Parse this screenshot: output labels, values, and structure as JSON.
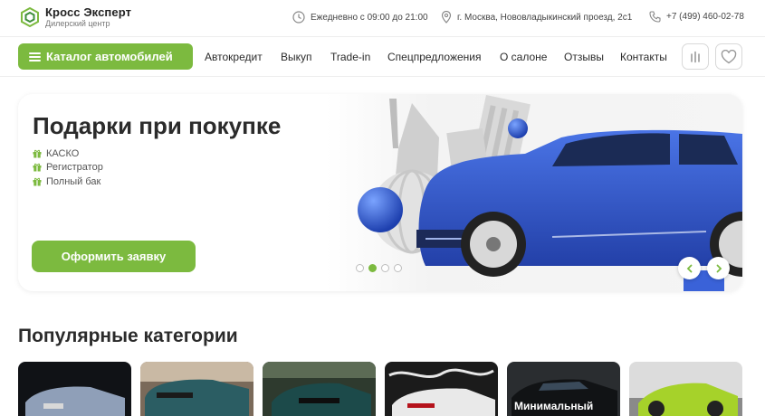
{
  "header": {
    "logo_title": "Кросс Эксперт",
    "logo_subtitle": "Дилерский центр",
    "hours": "Ежедневно с 09:00 до 21:00",
    "address": "г. Москва, Нововладыкинский проезд, 2с1",
    "phone": "+7 (499) 460-02-78"
  },
  "nav": {
    "catalog_label": "Каталог автомобилей",
    "links": [
      "Автокредит",
      "Выкуп",
      "Trade-in",
      "Спецпредложения",
      "О салоне",
      "Отзывы",
      "Контакты"
    ],
    "compare_icon": "compare-icon",
    "favorites_icon": "heart-icon"
  },
  "banner": {
    "title": "Подарки при покупке",
    "gifts": [
      "КАСКО",
      "Регистратор",
      "Полный бак"
    ],
    "cta_label": "Оформить заявку",
    "slides_count": 4,
    "active_slide": 2
  },
  "categories": {
    "title": "Популярные категории",
    "cards": [
      {
        "label": ""
      },
      {
        "label": ""
      },
      {
        "label": ""
      },
      {
        "label": ""
      },
      {
        "label": "Минимальный"
      },
      {
        "label": ""
      }
    ]
  },
  "colors": {
    "accent": "#7cba3f",
    "text": "#2b2b2b",
    "car_blue": "#2f55c7"
  }
}
